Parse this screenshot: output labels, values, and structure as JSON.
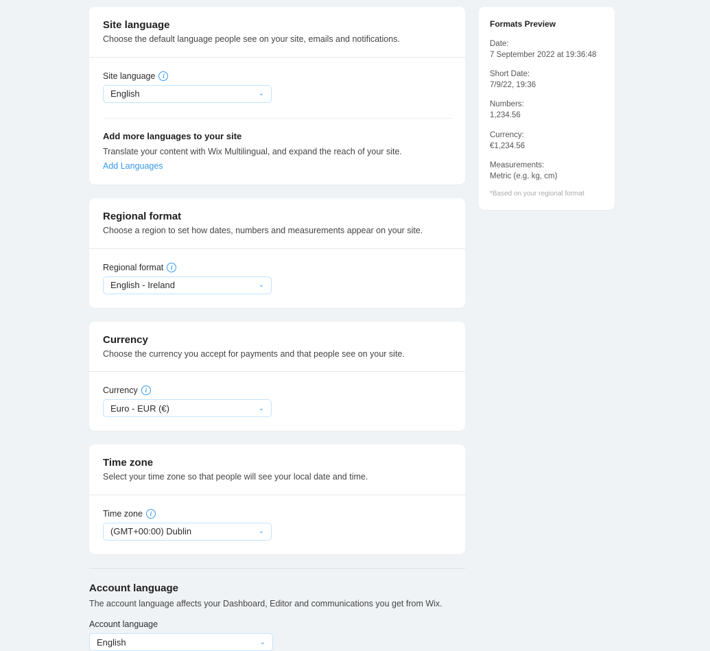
{
  "siteLanguage": {
    "title": "Site language",
    "desc": "Choose the default language people see on your site, emails and notifications.",
    "fieldLabel": "Site language",
    "value": "English",
    "addMore": {
      "heading": "Add more languages to your site",
      "text": "Translate your content with Wix Multilingual, and expand the reach of your site.",
      "link": "Add Languages"
    }
  },
  "regionalFormat": {
    "title": "Regional format",
    "desc": "Choose a region to set how dates, numbers and measurements appear on your site.",
    "fieldLabel": "Regional format",
    "value": "English - Ireland"
  },
  "currency": {
    "title": "Currency",
    "desc": "Choose the currency you accept for payments and that people see on your site.",
    "fieldLabel": "Currency",
    "value": "Euro - EUR (€)"
  },
  "timezone": {
    "title": "Time zone",
    "desc": "Select your time zone so that people will see your local date and time.",
    "fieldLabel": "Time zone",
    "value": "(GMT+00:00) Dublin"
  },
  "accountLanguage": {
    "title": "Account language",
    "desc": "The account language affects your Dashboard, Editor and communications you get from Wix.",
    "fieldLabel": "Account language",
    "value": "English"
  },
  "preview": {
    "title": "Formats Preview",
    "date": {
      "label": "Date:",
      "value": "7 September 2022 at 19:36:48"
    },
    "shortDate": {
      "label": "Short Date:",
      "value": "7/9/22, 19:36"
    },
    "numbers": {
      "label": "Numbers:",
      "value": "1,234.56"
    },
    "currency": {
      "label": "Currency:",
      "value": "€1,234.56"
    },
    "measurements": {
      "label": "Measurements:",
      "value": "Metric (e.g. kg, cm)"
    },
    "footnote": "*Based on your regional format"
  }
}
